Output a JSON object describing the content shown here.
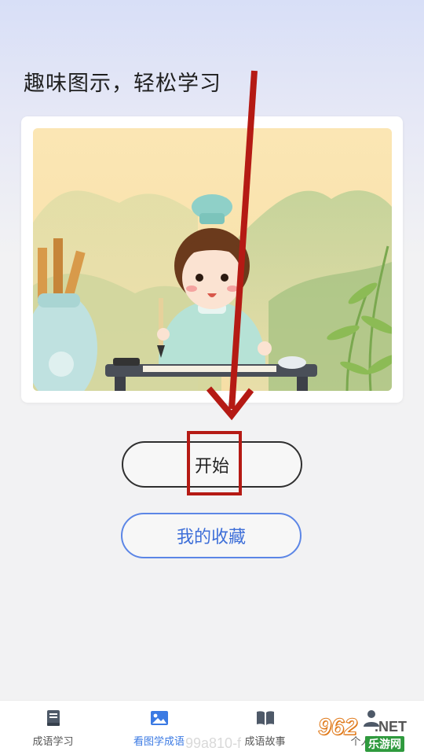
{
  "header": {
    "title": "趣味图示，轻松学习"
  },
  "illustration": {
    "icon": "child-calligraphy-illustration"
  },
  "actions": {
    "start_label": "开始",
    "favorites_label": "我的收藏"
  },
  "annotation": {
    "color": "#b51a14"
  },
  "tabbar": {
    "items": [
      {
        "label": "成语学习",
        "icon": "book-icon",
        "active": false
      },
      {
        "label": "看图学成语",
        "icon": "image-icon",
        "active": true
      },
      {
        "label": "成语故事",
        "icon": "open-book-icon",
        "active": false
      },
      {
        "label": "个人中心",
        "icon": "person-icon",
        "active": false
      }
    ],
    "active_color": "#3b7ae3"
  },
  "watermark": {
    "text": "99a810-f",
    "logo_number": "962",
    "logo_suffix": ".NET",
    "logo_cn": "乐游网"
  }
}
